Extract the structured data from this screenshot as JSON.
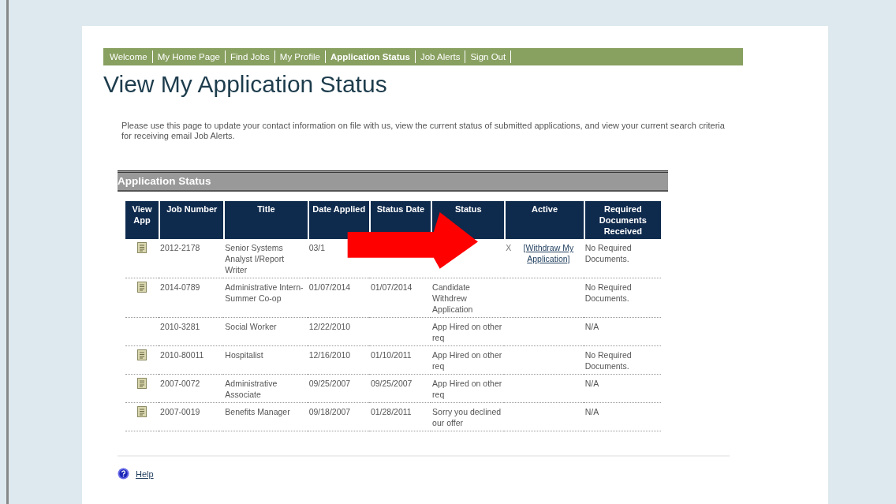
{
  "nav": [
    {
      "label": "Welcome",
      "selected": false
    },
    {
      "label": "My Home Page",
      "selected": false
    },
    {
      "label": "Find Jobs",
      "selected": false
    },
    {
      "label": "My Profile",
      "selected": false
    },
    {
      "label": "Application Status",
      "selected": true
    },
    {
      "label": "Job Alerts",
      "selected": false
    },
    {
      "label": "Sign Out",
      "selected": false
    }
  ],
  "title": "View My Application Status",
  "intro": "Please use this page to update your contact information on file with us, view the current status of submitted applications, and view your current search criteria for receiving email Job Alerts.",
  "section_title": "Application Status",
  "table": {
    "columns": [
      "View App",
      "Job Number",
      "Title",
      "Date Applied",
      "Status Date",
      "Status",
      "Active",
      "Required Documents Received"
    ],
    "rows": [
      {
        "has_document": true,
        "job_number": "2012-2178",
        "title": "Senior Systems Analyst I/Report Writer",
        "date_applied": "03/1",
        "status_date": "",
        "status": "",
        "active_mark": "X",
        "active_link": "[Withdraw My Application]",
        "documents": "No Required Documents."
      },
      {
        "has_document": true,
        "job_number": "2014-0789",
        "title": "Administrative Intern-Summer Co-op",
        "date_applied": "01/07/2014",
        "status_date": "01/07/2014",
        "status": "Candidate Withdrew Application",
        "documents": "No Required Documents."
      },
      {
        "has_document": false,
        "job_number": "2010-3281",
        "title": "Social Worker",
        "date_applied": "12/22/2010",
        "status_date": "",
        "status": "App Hired on other req",
        "documents": "N/A"
      },
      {
        "has_document": true,
        "job_number": "2010-80011",
        "title": "Hospitalist",
        "date_applied": "12/16/2010",
        "status_date": "01/10/2011",
        "status": "App Hired on other req",
        "documents": "No Required Documents."
      },
      {
        "has_document": true,
        "job_number": "2007-0072",
        "title": "Administrative Associate",
        "date_applied": "09/25/2007",
        "status_date": "09/25/2007",
        "status": "App Hired on other req",
        "documents": "N/A"
      },
      {
        "has_document": true,
        "job_number": "2007-0019",
        "title": "Benefits Manager",
        "date_applied": "09/18/2007",
        "status_date": "01/28/2011",
        "status": "Sorry you declined our offer",
        "documents": "N/A"
      }
    ]
  },
  "help_link": "Help"
}
